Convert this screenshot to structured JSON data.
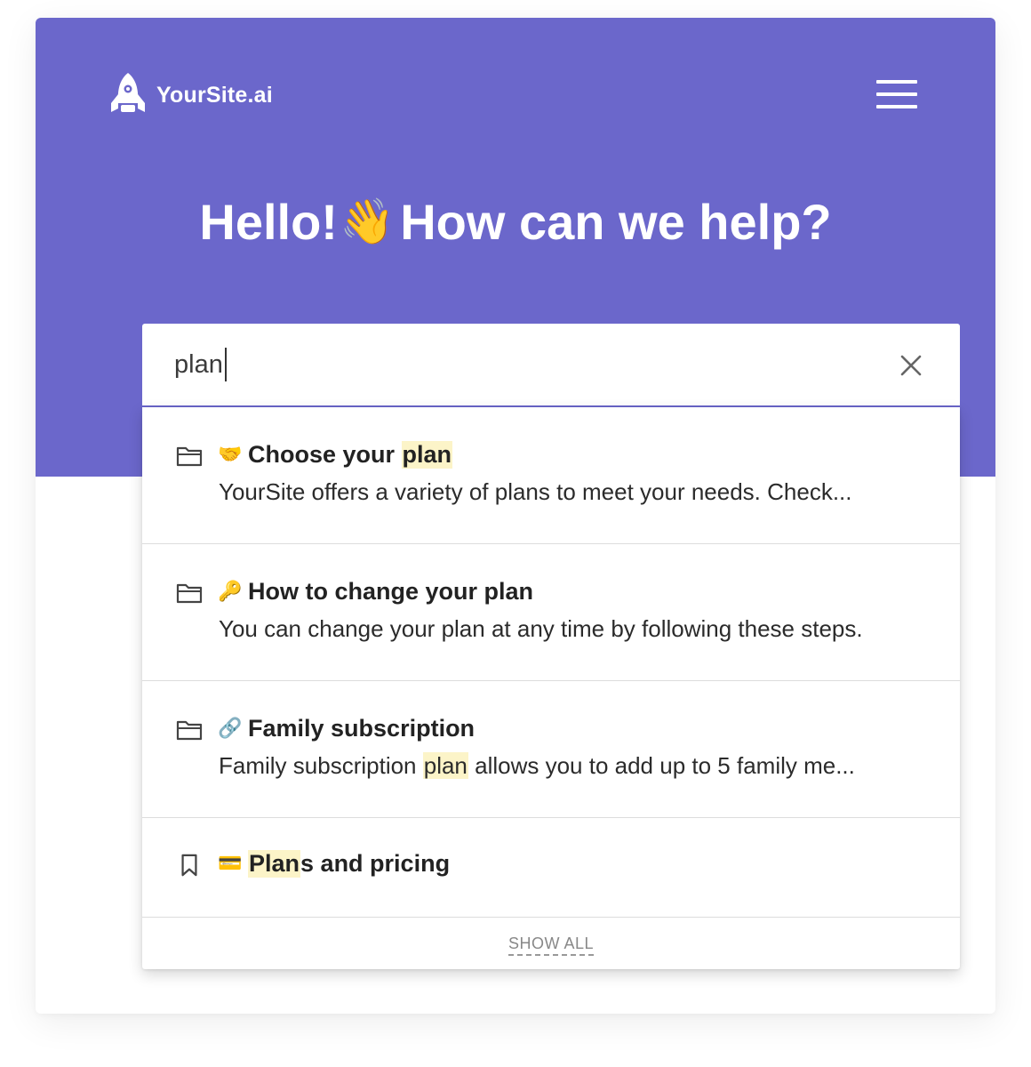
{
  "brand": {
    "name": "YourSite.ai",
    "hero_color": "#6b67cb"
  },
  "header": {
    "menu_icon": "hamburger-menu-icon"
  },
  "hero": {
    "greeting": "Hello!",
    "wave_emoji": "👋",
    "question": "How can we help?"
  },
  "search": {
    "value": "plan",
    "clear_icon": "close-icon"
  },
  "results": [
    {
      "type_icon": "folder-icon",
      "emoji": "🤝",
      "title_before": "Choose your ",
      "title_match": "plan",
      "title_after": "",
      "snippet_before": "YourSite offers a variety of plans to meet your needs. Check...",
      "snippet_match": "",
      "snippet_after": ""
    },
    {
      "type_icon": "folder-icon",
      "emoji": "🔑",
      "title_before": "How to change your plan",
      "title_match": "",
      "title_after": "",
      "snippet_before": "You can change your plan at any time by following these steps.",
      "snippet_match": "",
      "snippet_after": ""
    },
    {
      "type_icon": "folder-icon",
      "emoji": "🔗",
      "title_before": "Family subscription",
      "title_match": "",
      "title_after": "",
      "snippet_before": "Family subscription ",
      "snippet_match": "plan",
      "snippet_after": " allows you to add up to 5 family me..."
    },
    {
      "type_icon": "bookmark-icon",
      "emoji": "💳",
      "title_before": "",
      "title_match": "Plan",
      "title_after": "s and pricing",
      "snippet_before": "",
      "snippet_match": "",
      "snippet_after": ""
    }
  ],
  "show_all_label": "SHOW ALL",
  "highlight_color": "#fcf4c8"
}
